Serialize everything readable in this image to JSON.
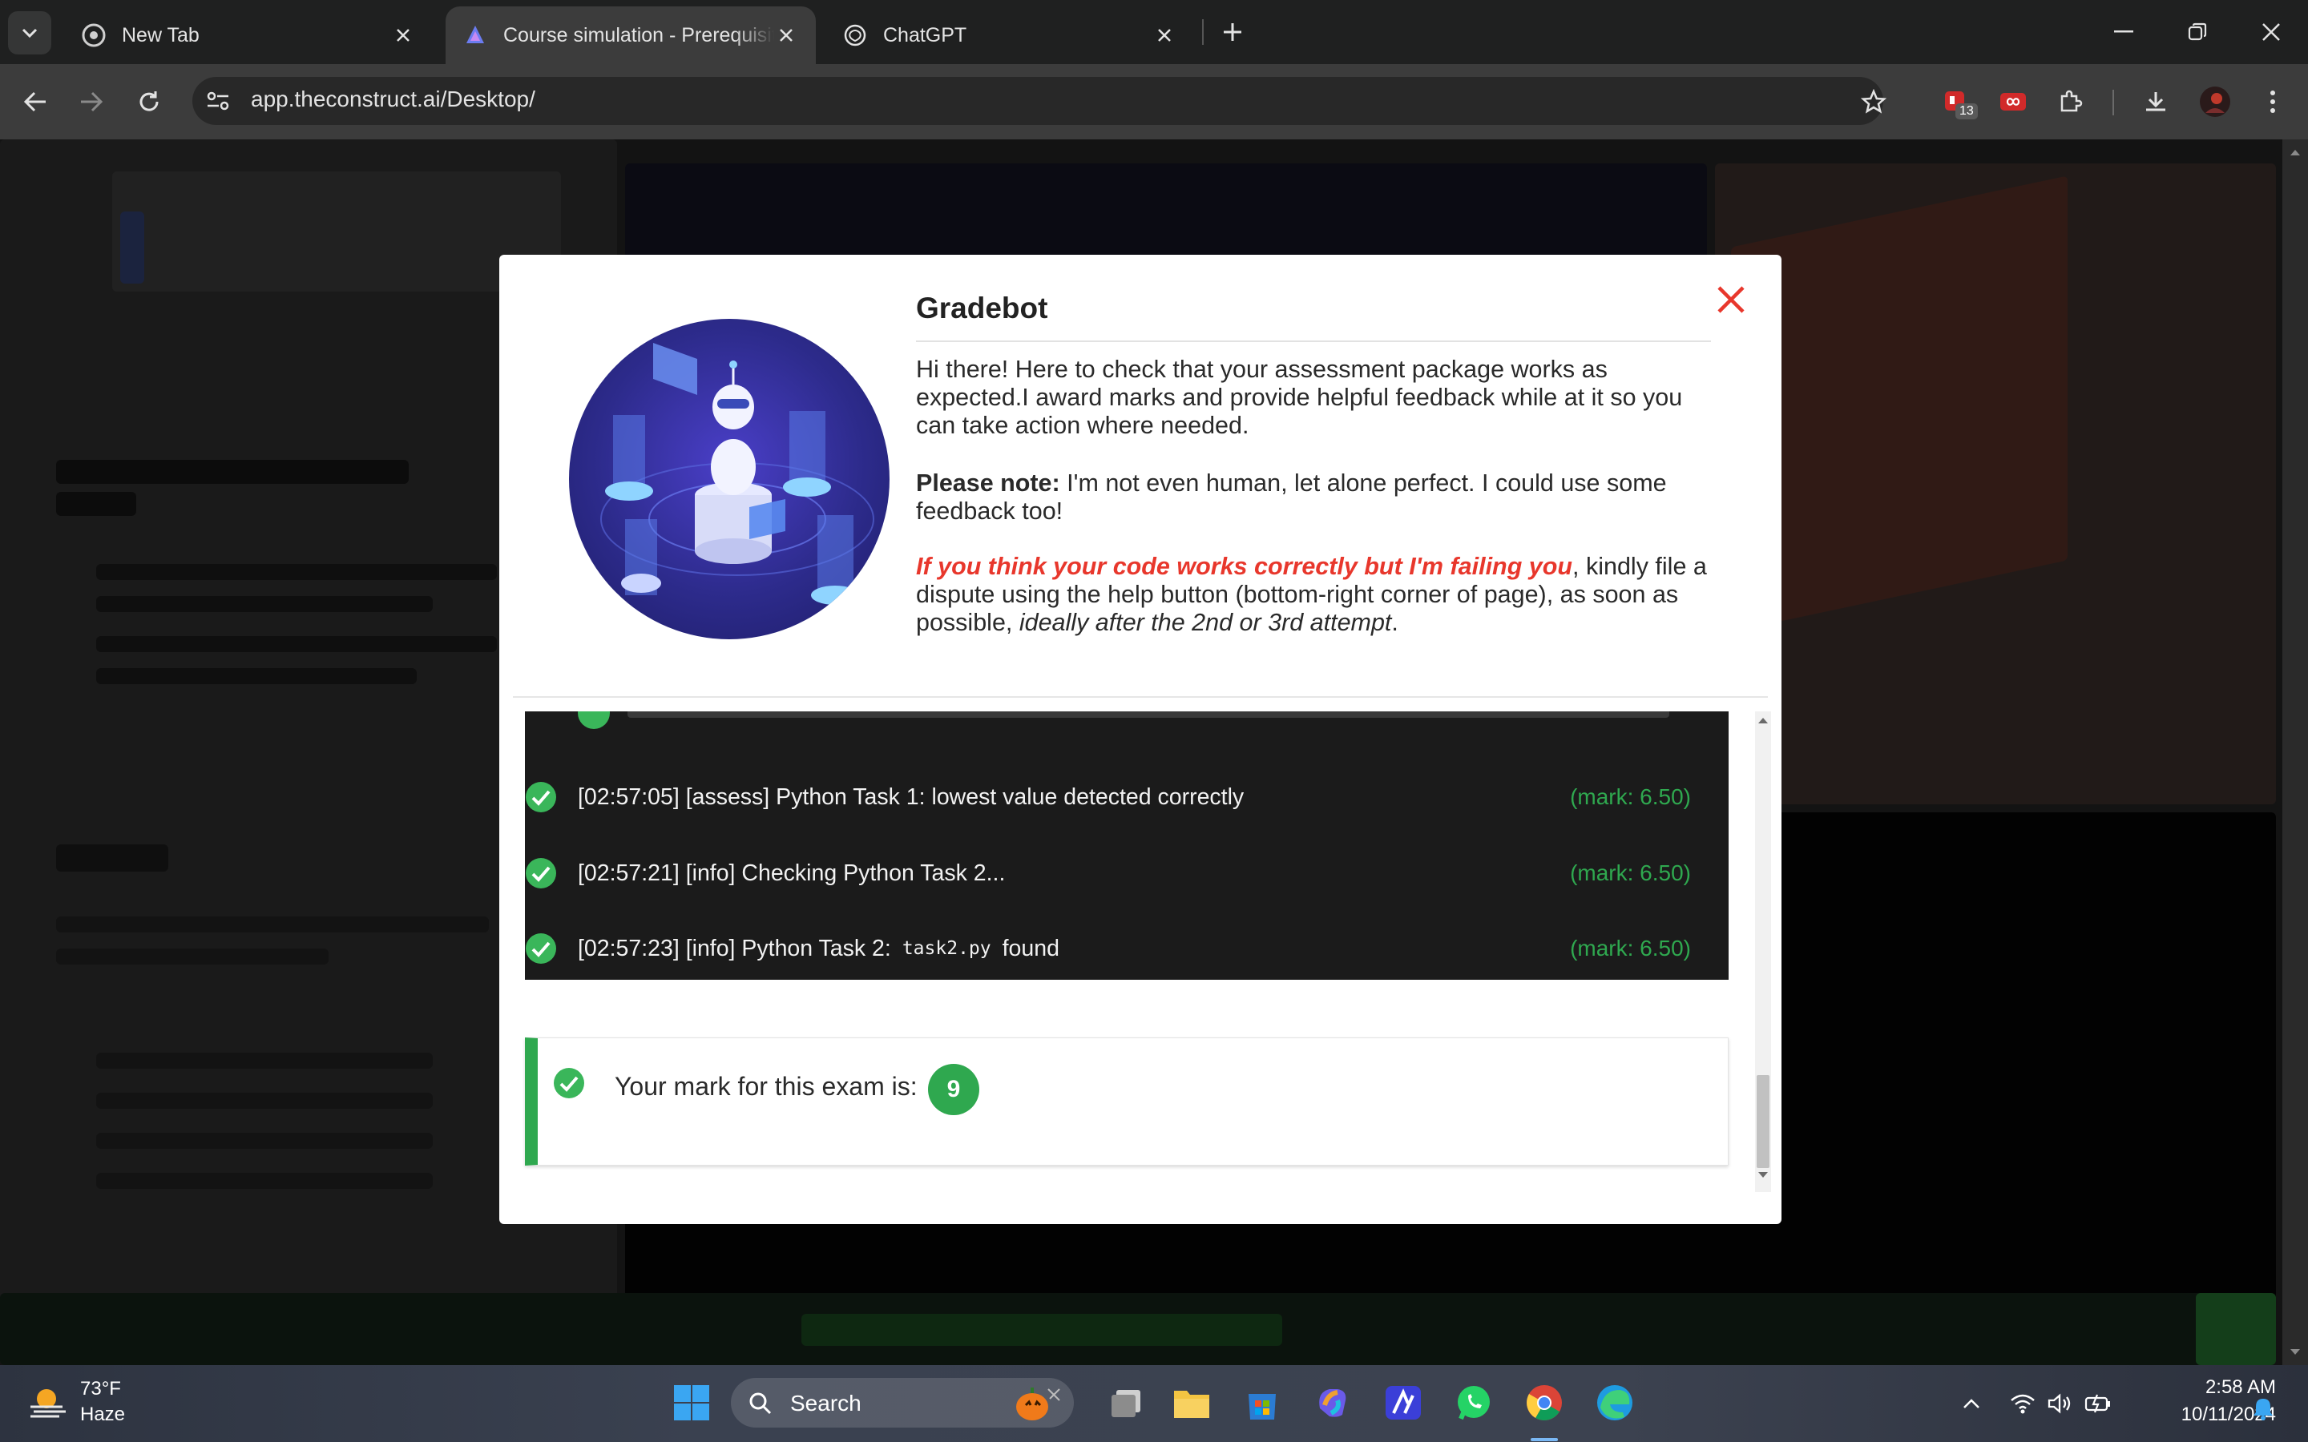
{
  "browser": {
    "tabs": [
      {
        "title": "New Tab",
        "active": false
      },
      {
        "title": "Course simulation - Prerequisite",
        "active": true
      },
      {
        "title": "ChatGPT",
        "active": false
      }
    ],
    "url": "app.theconstruct.ai/Desktop/",
    "extension_badge": "13"
  },
  "modal": {
    "title": "Gradebot",
    "intro": "Hi there! Here to check that your assessment package works as expected.I award marks and provide helpful feedback while at it so you can take action where needed.",
    "note_label": "Please note:",
    "note_text": " I'm not even human, let alone perfect. I could use some feedback too!",
    "dispute_red": "If you think your code works correctly but I'm failing you",
    "dispute_text": ", kindly file a dispute using the help button (bottom-right corner of page), as soon as possible, ",
    "dispute_italic": "ideally after the 2nd or 3rd attempt",
    "dispute_end": ".",
    "log": [
      {
        "text_before": "[02:57:05] [assess] Python Task 1: lowest value detected correctly",
        "code": "",
        "text_after": "",
        "mark": "(mark: 6.50)"
      },
      {
        "text_before": "[02:57:21] [info] Checking Python Task 2...",
        "code": "",
        "text_after": "",
        "mark": "(mark: 6.50)"
      },
      {
        "text_before": "[02:57:23] [info] Python Task 2:",
        "code": "task2.py",
        "text_after": "found",
        "mark": "(mark: 6.50)"
      }
    ],
    "result_label": "Your mark for this exam is:",
    "result_value": "9"
  },
  "taskbar": {
    "temperature": "73°F",
    "condition": "Haze",
    "search_placeholder": "Search",
    "time": "2:58 AM",
    "date": "10/11/2024"
  },
  "colors": {
    "accent_green": "#2fa84f",
    "accent_red": "#e8372c"
  }
}
